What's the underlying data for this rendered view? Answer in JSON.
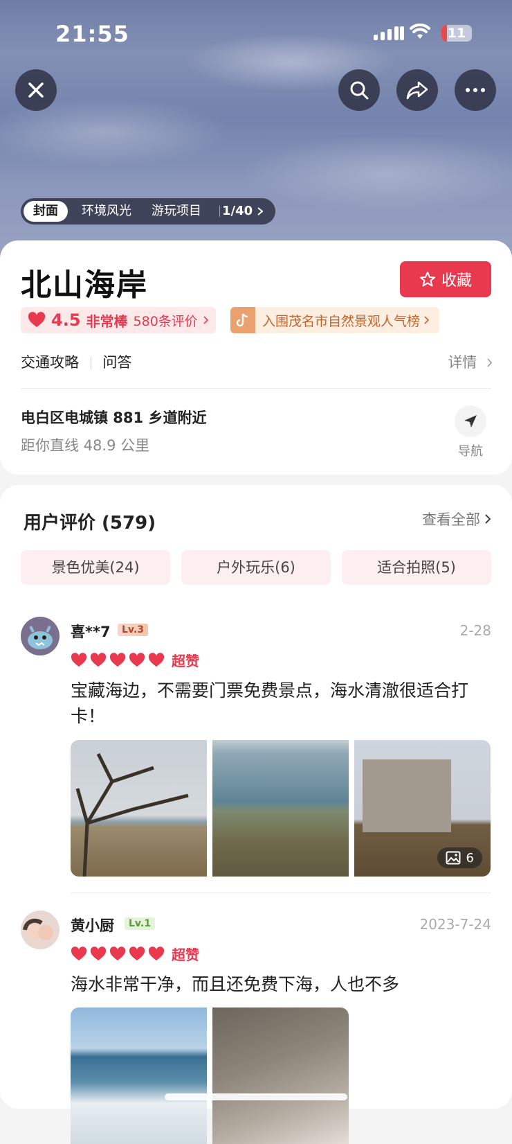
{
  "status_bar": {
    "time": "21:55",
    "battery": "11"
  },
  "gallery_tabs": [
    {
      "label": "封面",
      "active": true
    },
    {
      "label": "环境风光",
      "active": false
    },
    {
      "label": "游玩项目",
      "active": false
    }
  ],
  "gallery_counter": "1/40",
  "poi": {
    "name": "北山海岸",
    "favorite_label": "收藏",
    "score": "4.5",
    "score_text": "非常棒",
    "review_count_text": "580条评价",
    "rank_text": "入围茂名市自然景观人气榜",
    "links": [
      "交通攻略",
      "问答"
    ],
    "detail_label": "详情",
    "address": "电白区电城镇 881 乡道附近",
    "distance": "距你直线 48.9 公里",
    "nav_label": "导航"
  },
  "reviews_section": {
    "title": "用户评价 (579)",
    "see_all": "查看全部",
    "tags": [
      "景色优美(24)",
      "户外玩乐(6)",
      "适合拍照(5)"
    ]
  },
  "reviews": [
    {
      "user": "喜**7",
      "level": "Lv.3",
      "date": "2-28",
      "rating_word": "超赞",
      "hearts": 5,
      "text": "宝藏海边，不需要门票免费景点，海水清澈很适合打卡！",
      "photo_count": "6"
    },
    {
      "user": "黄小厨",
      "level": "Lv.1",
      "date": "2023-7-24",
      "rating_word": "超赞",
      "hearts": 5,
      "text": "海水非常干净，而且还免费下海，人也不多"
    }
  ],
  "colors": {
    "accent": "#e8394f",
    "rank_orange": "#d9773a"
  }
}
